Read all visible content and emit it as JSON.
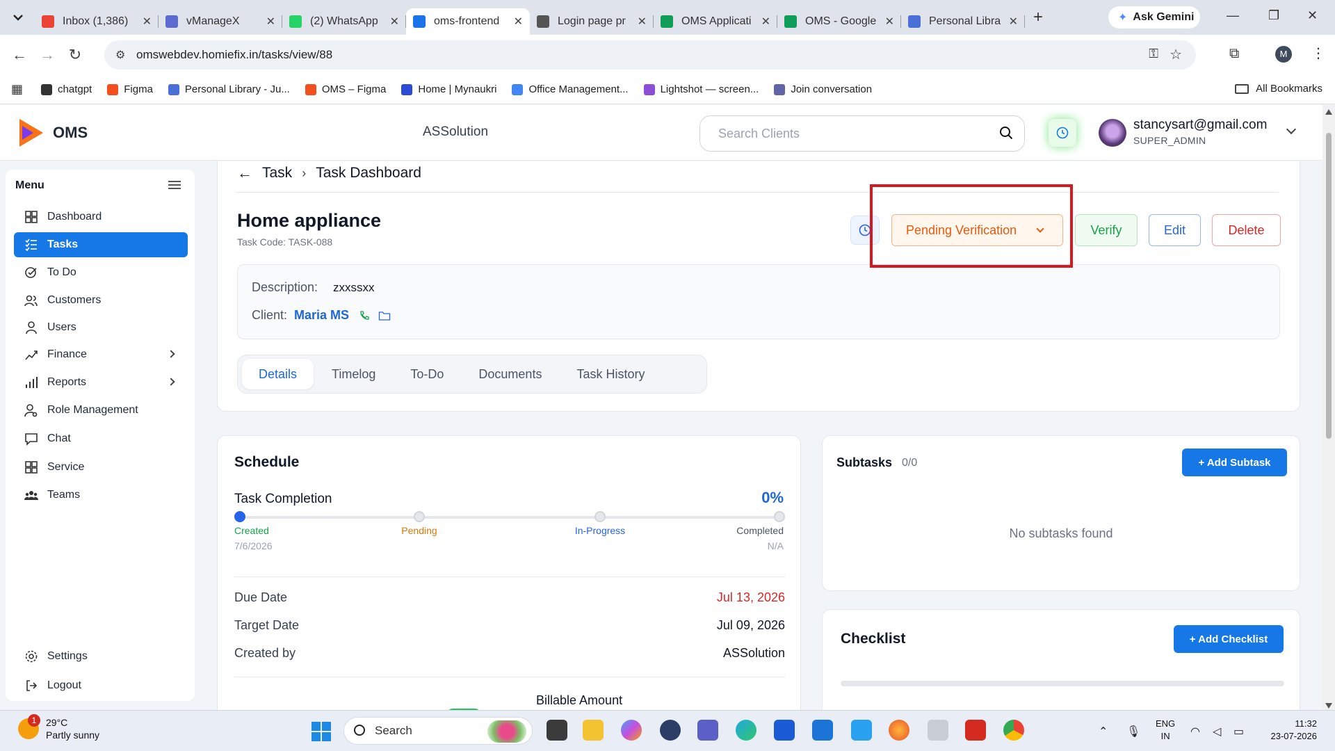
{
  "browser": {
    "tabs": [
      {
        "title": "Inbox (1,386)",
        "color": "#ea4335"
      },
      {
        "title": "vManageX",
        "color": "#5b6bd0"
      },
      {
        "title": "(2) WhatsApp",
        "color": "#25d366"
      },
      {
        "title": "oms-frontend",
        "color": "#1a73e8",
        "active": true
      },
      {
        "title": "Login page pr",
        "color": "#555555"
      },
      {
        "title": "OMS Applicati",
        "color": "#0f9d58"
      },
      {
        "title": "OMS - Google",
        "color": "#0f9d58"
      },
      {
        "title": "Personal Libra",
        "color": "#4a6fd6"
      }
    ],
    "gemini_label": "Ask Gemini",
    "url": "omswebdev.homiefix.in/tasks/view/88",
    "profile_initial": "M",
    "bookmarks": [
      {
        "label": "chatgpt",
        "color": "#333333"
      },
      {
        "label": "Figma",
        "color": "#f24e1e"
      },
      {
        "label": "Personal Library - Ju...",
        "color": "#4a6fd6"
      },
      {
        "label": "OMS – Figma",
        "color": "#f24e1e"
      },
      {
        "label": "Home | Mynaukri",
        "color": "#2b4bd6"
      },
      {
        "label": "Office Management...",
        "color": "#4285f4"
      },
      {
        "label": "Lightshot — screen...",
        "color": "#8a4fd6"
      },
      {
        "label": "Join conversation",
        "color": "#6264a7"
      }
    ],
    "all_bookmarks": "All Bookmarks"
  },
  "header": {
    "app_name": "OMS",
    "company": "ASSolution",
    "search_placeholder": "Search Clients",
    "user_email": "stancysart@gmail.com",
    "user_role": "SUPER_ADMIN"
  },
  "sidebar": {
    "menu_label": "Menu",
    "items": [
      {
        "label": "Dashboard",
        "icon": "dashboard-icon"
      },
      {
        "label": "Tasks",
        "icon": "tasks-icon",
        "active": true
      },
      {
        "label": "To Do",
        "icon": "todo-icon"
      },
      {
        "label": "Customers",
        "icon": "customers-icon"
      },
      {
        "label": "Users",
        "icon": "users-icon"
      },
      {
        "label": "Finance",
        "icon": "finance-icon",
        "has_children": true
      },
      {
        "label": "Reports",
        "icon": "reports-icon",
        "has_children": true
      },
      {
        "label": "Role Management",
        "icon": "role-management-icon"
      },
      {
        "label": "Chat",
        "icon": "chat-icon"
      },
      {
        "label": "Service",
        "icon": "service-icon"
      },
      {
        "label": "Teams",
        "icon": "teams-icon"
      }
    ],
    "settings_label": "Settings",
    "logout_label": "Logout"
  },
  "task": {
    "breadcrumb_parent": "Task",
    "breadcrumb_current": "Task Dashboard",
    "title": "Home appliance",
    "code": "Task Code: TASK-088",
    "status": "Pending Verification",
    "verify_label": "Verify",
    "edit_label": "Edit",
    "delete_label": "Delete",
    "description_label": "Description:",
    "description": "zxxssxx",
    "client_label": "Client:",
    "client_name": "Maria MS",
    "tabs": [
      "Details",
      "Timelog",
      "To-Do",
      "Documents",
      "Task History"
    ],
    "active_tab": "Details"
  },
  "schedule": {
    "title": "Schedule",
    "completion_label": "Task Completion",
    "completion_pct": "0%",
    "completion_value": 0,
    "steps": [
      {
        "label": "Created",
        "date": "7/6/2026",
        "color": "#16a34a",
        "done": true
      },
      {
        "label": "Pending",
        "date": "",
        "color": "#d97706",
        "done": false
      },
      {
        "label": "In-Progress",
        "date": "",
        "color": "#2563eb",
        "done": false
      },
      {
        "label": "Completed",
        "date": "N/A",
        "color": "#4b5563",
        "done": false
      }
    ],
    "due_date_label": "Due Date",
    "due_date": "Jul 13, 2026",
    "target_date_label": "Target Date",
    "target_date": "Jul 09, 2026",
    "created_by_label": "Created by",
    "created_by": "ASSolution",
    "billable_label": "Billable Amount"
  },
  "subtasks": {
    "title": "Subtasks",
    "count": "0/0",
    "add_label": "+ Add Subtask",
    "empty_text": "No subtasks found"
  },
  "checklist": {
    "title": "Checklist",
    "add_label": "+ Add Checklist"
  },
  "taskbar": {
    "weather_badge": "1",
    "temp": "29°C",
    "condition": "Partly sunny",
    "search_label": "Search",
    "lang_top": "ENG",
    "lang_bottom": "IN",
    "time": "11:32",
    "date": "23-07-2026"
  },
  "colors": {
    "primary": "#1677e6",
    "status_orange": "#ea580c",
    "verify_green": "#16a34a",
    "delete_red": "#dc2626",
    "highlight_red": "#d7191f"
  }
}
